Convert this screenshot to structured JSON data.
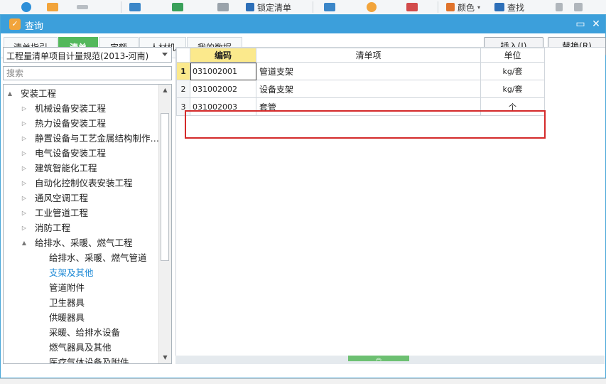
{
  "app_toolbar": {
    "items": [
      {
        "label": ""
      },
      {
        "label": ""
      },
      {
        "label": ""
      },
      {
        "label": ""
      },
      {
        "label": ""
      },
      {
        "label": "锁定清单"
      },
      {
        "label": ""
      },
      {
        "label": ""
      },
      {
        "label": ""
      },
      {
        "label": "颜色"
      },
      {
        "label": "查找"
      }
    ]
  },
  "dialog": {
    "title": "查询",
    "minimize_symbol": "▭",
    "close_symbol": "✕"
  },
  "tabs": [
    {
      "label": "清单指引"
    },
    {
      "label": "清单",
      "active": true
    },
    {
      "label": "定额"
    },
    {
      "label": "人材机"
    },
    {
      "label": "我的数据"
    }
  ],
  "actions": {
    "insert_label": "插入(I)",
    "replace_label": "替换(R)"
  },
  "left_panel": {
    "spec_dropdown_value": "工程量清单项目计量规范(2013-河南)",
    "search_placeholder": "搜索",
    "tree": [
      {
        "label": "安装工程",
        "level": 0,
        "toggle": "▲"
      },
      {
        "label": "机械设备安装工程",
        "level": 1,
        "toggle": "▷"
      },
      {
        "label": "热力设备安装工程",
        "level": 1,
        "toggle": "▷"
      },
      {
        "label": "静置设备与工艺金属结构制作…",
        "level": 1,
        "toggle": "▷"
      },
      {
        "label": "电气设备安装工程",
        "level": 1,
        "toggle": "▷"
      },
      {
        "label": "建筑智能化工程",
        "level": 1,
        "toggle": "▷"
      },
      {
        "label": "自动化控制仪表安装工程",
        "level": 1,
        "toggle": "▷"
      },
      {
        "label": "通风空调工程",
        "level": 1,
        "toggle": "▷"
      },
      {
        "label": "工业管道工程",
        "level": 1,
        "toggle": "▷"
      },
      {
        "label": "消防工程",
        "level": 1,
        "toggle": "▷"
      },
      {
        "label": "给排水、采暖、燃气工程",
        "level": 1,
        "toggle": "▲"
      },
      {
        "label": "给排水、采暖、燃气管道",
        "level": 2,
        "toggle": ""
      },
      {
        "label": "支架及其他",
        "level": 2,
        "toggle": "",
        "selected": true
      },
      {
        "label": "管道附件",
        "level": 2,
        "toggle": ""
      },
      {
        "label": "卫生器具",
        "level": 2,
        "toggle": ""
      },
      {
        "label": "供暖器具",
        "level": 2,
        "toggle": ""
      },
      {
        "label": "采暖、给排水设备",
        "level": 2,
        "toggle": ""
      },
      {
        "label": "燃气器具及其他",
        "level": 2,
        "toggle": ""
      },
      {
        "label": "医疗气体设备及附件",
        "level": 2,
        "toggle": ""
      }
    ]
  },
  "grid": {
    "headers": {
      "code": "编码",
      "name": "清单项",
      "unit": "单位"
    },
    "rows": [
      {
        "n": "1",
        "code": "031002001",
        "name": "管道支架",
        "unit": "kg/套",
        "active": true
      },
      {
        "n": "2",
        "code": "031002002",
        "name": "设备支架",
        "unit": "kg/套"
      },
      {
        "n": "3",
        "code": "031002003",
        "name": "套管",
        "unit": "个"
      }
    ]
  },
  "bottom_handle_symbol": "︽",
  "colors": {
    "title_bar": "#3c9fdb",
    "active_tab": "#54b85c",
    "header_highlight": "#fbe98c",
    "selection_box": "#d42a2a",
    "selected_tree_text": "#1f8ad6"
  }
}
